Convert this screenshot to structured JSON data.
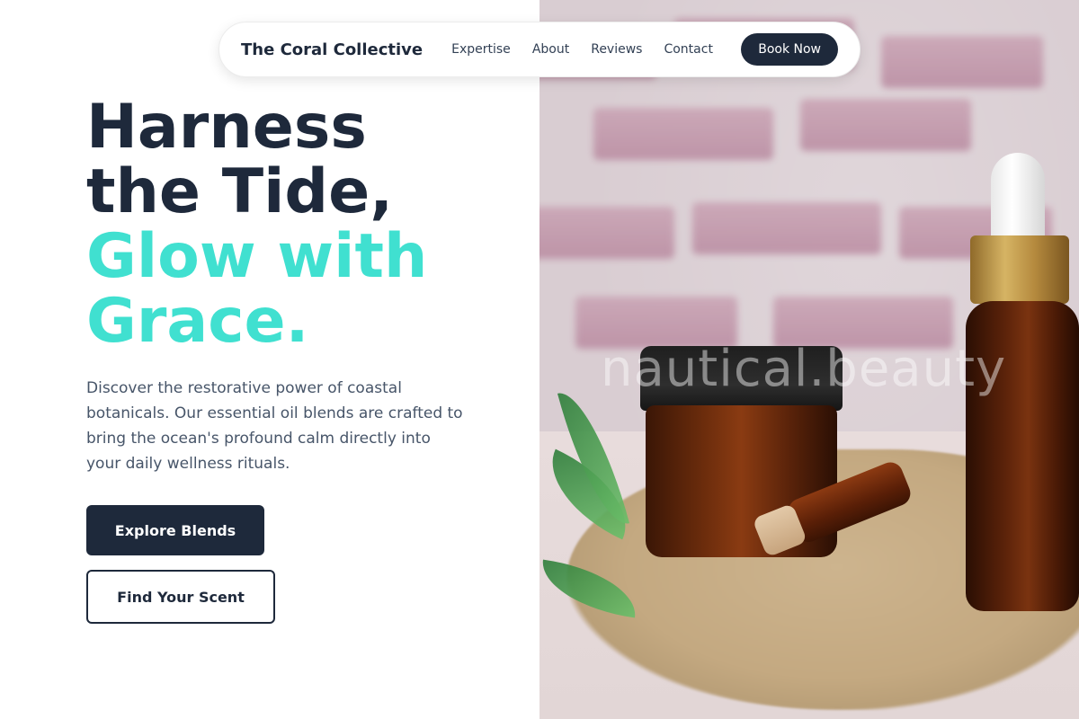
{
  "nav": {
    "brand": "The Coral Collective",
    "links": [
      "Expertise",
      "About",
      "Reviews",
      "Contact"
    ],
    "cta": "Book Now"
  },
  "hero": {
    "title_line1": "Harness",
    "title_line2": "the Tide,",
    "title_accent_line1": "Glow with",
    "title_accent_line2": "Grace.",
    "description": "Discover the restorative power of coastal botanicals. Our essential oil blends are crafted to bring the ocean's profound calm directly into your daily wellness rituals.",
    "primary_button": "Explore Blends",
    "secondary_button": "Find Your Scent"
  },
  "image": {
    "watermark": "nautical.beauty",
    "subject": "essential-oil-products-photo"
  },
  "colors": {
    "dark": "#1e293b",
    "accent": "#40e0d0",
    "body_text": "#475569"
  }
}
